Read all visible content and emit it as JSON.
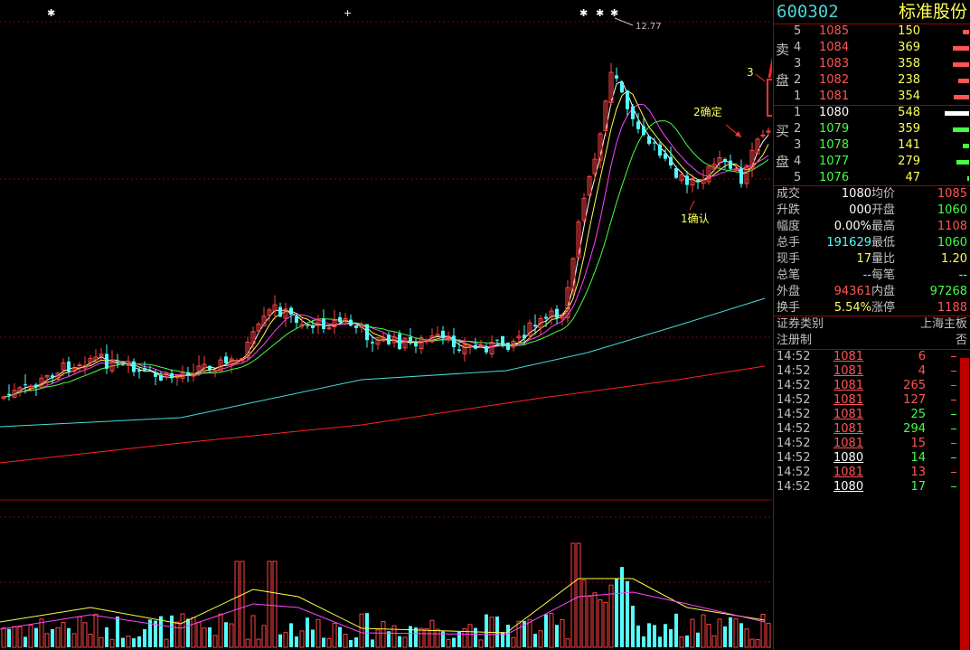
{
  "stock": {
    "code": "600302",
    "name": "标准股份"
  },
  "side_labels": {
    "sell_1": "卖",
    "sell_2": "盘",
    "buy_1": "买",
    "buy_2": "盘"
  },
  "sell_book": [
    {
      "level": "5",
      "price": "1085",
      "volume": "150",
      "bar": 0.18
    },
    {
      "level": "4",
      "price": "1084",
      "volume": "369",
      "bar": 0.45
    },
    {
      "level": "3",
      "price": "1083",
      "volume": "358",
      "bar": 0.44
    },
    {
      "level": "2",
      "price": "1082",
      "volume": "238",
      "bar": 0.29
    },
    {
      "level": "1",
      "price": "1081",
      "volume": "354",
      "bar": 0.43
    }
  ],
  "buy_book": [
    {
      "level": "1",
      "price": "1080",
      "volume": "548",
      "bar": 0.68
    },
    {
      "level": "2",
      "price": "1079",
      "volume": "359",
      "bar": 0.44
    },
    {
      "level": "3",
      "price": "1078",
      "volume": "141",
      "bar": 0.17
    },
    {
      "level": "4",
      "price": "1077",
      "volume": "279",
      "bar": 0.34
    },
    {
      "level": "5",
      "price": "1076",
      "volume": "47",
      "bar": 0.06
    }
  ],
  "quote": [
    {
      "l1": "成交",
      "v1": "1080",
      "c1": "white",
      "l2": "均价",
      "v2": "1085",
      "c2": "red"
    },
    {
      "l1": "升跌",
      "v1": "000",
      "c1": "white",
      "l2": "开盘",
      "v2": "1060",
      "c2": "green"
    },
    {
      "l1": "幅度",
      "v1": "0.00%",
      "c1": "white",
      "l2": "最高",
      "v2": "1108",
      "c2": "red"
    },
    {
      "l1": "总手",
      "v1": "191629",
      "c1": "cyan",
      "l2": "最低",
      "v2": "1060",
      "c2": "green"
    },
    {
      "l1": "现手",
      "v1": "17",
      "c1": "yellow",
      "l2": "量比",
      "v2": "1.20",
      "c2": "yellow"
    },
    {
      "l1": "总笔",
      "v1": "--",
      "c1": "cyan",
      "l2": "每笔",
      "v2": "--",
      "c2": "cyan"
    },
    {
      "l1": "外盘",
      "v1": "94361",
      "c1": "red",
      "l2": "内盘",
      "v2": "97268",
      "c2": "green"
    },
    {
      "l1": "换手",
      "v1": "5.54%",
      "c1": "yellow",
      "l2": "涨停",
      "v2": "1188",
      "c2": "red"
    }
  ],
  "info": [
    {
      "label": "证券类别",
      "value": "上海主板"
    },
    {
      "label": "注册制",
      "value": "否"
    }
  ],
  "trades": [
    {
      "time": "14:52",
      "price": "1081",
      "vol": "6",
      "pc": "red",
      "vc": "red"
    },
    {
      "time": "14:52",
      "price": "1081",
      "vol": "4",
      "pc": "red",
      "vc": "red"
    },
    {
      "time": "14:52",
      "price": "1081",
      "vol": "265",
      "pc": "red",
      "vc": "red"
    },
    {
      "time": "14:52",
      "price": "1081",
      "vol": "127",
      "pc": "red",
      "vc": "red"
    },
    {
      "time": "14:52",
      "price": "1081",
      "vol": "25",
      "pc": "red",
      "vc": "green"
    },
    {
      "time": "14:52",
      "price": "1081",
      "vol": "294",
      "pc": "red",
      "vc": "green"
    },
    {
      "time": "14:52",
      "price": "1081",
      "vol": "15",
      "pc": "red",
      "vc": "red"
    },
    {
      "time": "14:52",
      "price": "1080",
      "vol": "14",
      "pc": "white",
      "vc": "green"
    },
    {
      "time": "14:52",
      "price": "1081",
      "vol": "13",
      "pc": "red",
      "vc": "red"
    },
    {
      "time": "14:52",
      "price": "1080",
      "vol": "17",
      "pc": "white",
      "vc": "green"
    }
  ],
  "annotations": {
    "peak_label": "12.77",
    "note_1": "1确认",
    "note_2": "2确定",
    "note_3": "3"
  },
  "colors": {
    "up": "#ff4444",
    "down": "#54fcfc",
    "ma5": "#ffffff",
    "ma10": "#ffff44",
    "ma20": "#ff44ff",
    "ma30": "#44ff44",
    "ma60": "#44dddd",
    "ma120": "#ff2222",
    "grid": "#8b0000"
  }
}
